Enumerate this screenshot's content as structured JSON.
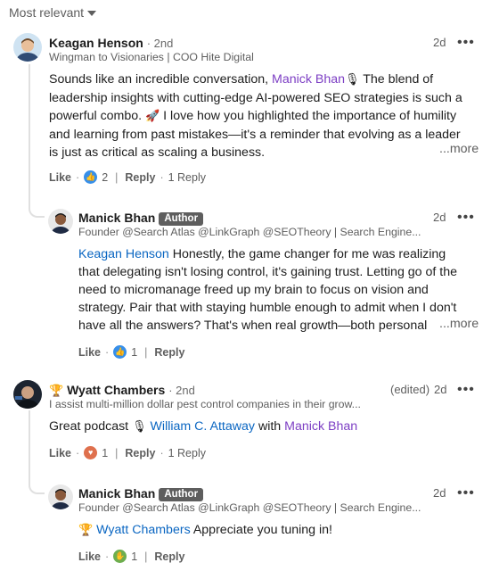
{
  "sort": {
    "label": "Most relevant"
  },
  "comments": [
    {
      "author": "Keagan Henson",
      "degree": "· 2nd",
      "headline": "Wingman to Visionaries | COO Hite Digital",
      "time": "2d",
      "body_lines": [
        {
          "pre": "Sounds like an incredible conversation, ",
          "mention": "Manick Bhan",
          "post": " The blend of"
        },
        "leadership insights with cutting-edge AI-powered SEO strategies is such a",
        {
          "pre": "powerful combo. ",
          "post": " I love how you highlighted the importance of humility"
        },
        "and learning from past mistakes—it's a reminder that evolving as a leader",
        "is just as critical as scaling a business."
      ],
      "more": "...more",
      "like": "Like",
      "reaction_count": "2",
      "reply": "Reply",
      "replies": "1 Reply"
    },
    {
      "author": "Manick Bhan",
      "badge": "Author",
      "headline": "Founder @Search Atlas @LinkGraph @SEOTheory | Search Engine...",
      "time": "2d",
      "mention": "Keagan Henson",
      "body_lines": [
        " Honestly, the game changer for me was realizing",
        "that delegating isn't losing control, it's gaining trust. Letting go of the",
        "need to micromanage freed up my brain to focus on vision and",
        "strategy. Pair that with staying humble enough to admit when I don't",
        "have all the answers? That's when real growth—both personal"
      ],
      "more": "...more",
      "like": "Like",
      "reaction_count": "1",
      "reply": "Reply"
    },
    {
      "author": "Wyatt Chambers",
      "degree": "· 2nd",
      "headline": "I assist multi-million dollar pest control companies in their grow...",
      "edited": "(edited)",
      "time": "2d",
      "body_pre": "Great podcast ",
      "mention1": "William C. Attaway",
      "body_mid": " with ",
      "mention2": "Manick Bhan",
      "like": "Like",
      "reaction_count": "1",
      "reply": "Reply",
      "replies": "1 Reply"
    },
    {
      "author": "Manick Bhan",
      "badge": "Author",
      "headline": "Founder @Search Atlas @LinkGraph @SEOTheory | Search Engine...",
      "time": "2d",
      "mention": "Wyatt Chambers",
      "body": " Appreciate you tuning in!",
      "like": "Like",
      "reaction_count": "1",
      "reply": "Reply"
    }
  ],
  "icons": {
    "microphone": "microphone-icon",
    "rocket": "rocket-icon",
    "trophy": "trophy-icon",
    "like": "like-reaction-icon",
    "love": "love-reaction-icon",
    "celebrate": "celebrate-reaction-icon",
    "more": "ellipsis-icon"
  },
  "colors": {
    "mention_purple": "#7d3fc4",
    "mention_blue": "#0a66c2",
    "like_blue": "#378fe9",
    "love_red": "#df704d",
    "celebrate_green": "#6dae4f",
    "author_badge": "#5e5e5e"
  }
}
